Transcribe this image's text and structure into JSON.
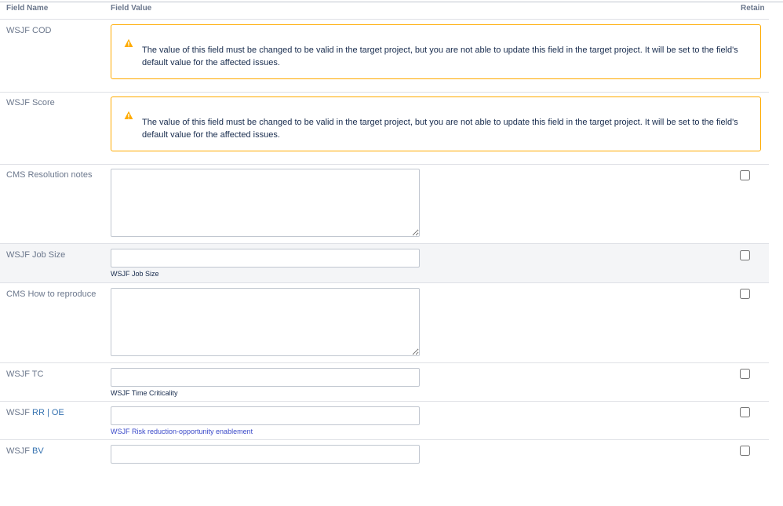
{
  "header": {
    "field_name": "Field Name",
    "field_value": "Field Value",
    "retain": "Retain"
  },
  "rows": {
    "wsjf_cod": {
      "label": "WSJF COD",
      "warning": "The value of this field must be changed to be valid in the target project, but you are not able to update this field in the target project. It will be set to the field's default value for the affected issues."
    },
    "wsjf_score": {
      "label": "WSJF Score",
      "warning": "The value of this field must be changed to be valid in the target project, but you are not able to update this field in the target project. It will be set to the field's default value for the affected issues."
    },
    "cms_resolution_notes": {
      "label": "CMS Resolution notes",
      "value": "",
      "retain": false
    },
    "wsjf_job_size": {
      "label": "WSJF Job Size",
      "value": "",
      "description": "WSJF Job Size",
      "retain": false
    },
    "cms_how_to_reproduce": {
      "label": "CMS How to reproduce",
      "value": "",
      "retain": false
    },
    "wsjf_tc": {
      "label": "WSJF TC",
      "value": "",
      "description": "WSJF Time Criticality",
      "retain": false
    },
    "wsjf_rr_oe": {
      "label_prefix": "WSJF ",
      "label_rr": "RR",
      "label_sep": " | ",
      "label_oe": "OE",
      "value": "",
      "description": "WSJF Risk reduction-opportunity enablement",
      "retain": false
    },
    "wsjf_bv": {
      "label_prefix": "WSJF ",
      "label_bv": "BV",
      "value": "",
      "retain": false
    }
  },
  "colors": {
    "warning_border": "#ffab00",
    "warning_icon": "#ffab00",
    "link": "#3572b0",
    "label": "#6b778c",
    "row_highlight": "#f4f5f7"
  },
  "icons": {
    "warning": "warning-triangle-icon"
  }
}
